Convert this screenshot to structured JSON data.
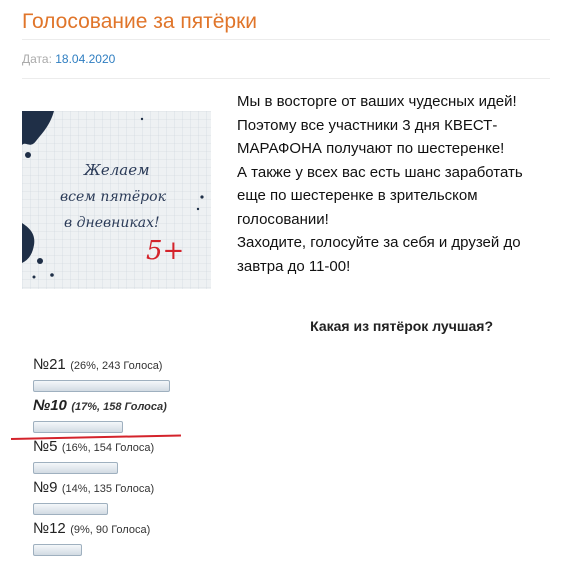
{
  "page": {
    "title": "Голосование за пятёрки",
    "date_label": "Дата:",
    "date_value": "18.04.2020"
  },
  "image": {
    "line1": "Желаем",
    "line2": "всем пятёрок",
    "line3": "в дневниках!",
    "mark": "5+"
  },
  "text": {
    "lines": [
      "Мы в восторге от ваших чудесных идей!",
      "Поэтому все участники 3 дня КВЕСТ-МАРАФОНА получают по шестеренке!",
      "А также у всех вас есть шанс заработать еще по шестеренке в зрительском голосовании!",
      "Заходите, голосуйте за себя и друзей до завтра до 11-00!"
    ]
  },
  "poll": {
    "question": "Какая из пятёрок лучшая?",
    "items": [
      {
        "label": "№21",
        "meta": "(26%, 243 Голоса)",
        "percent": 26
      },
      {
        "label": "№10",
        "meta": "(17%, 158 Голоса)",
        "percent": 17
      },
      {
        "label": "№5",
        "meta": "(16%, 154 Голоса)",
        "percent": 16
      },
      {
        "label": "№9",
        "meta": "(14%, 135 Голоса)",
        "percent": 14
      },
      {
        "label": "№12",
        "meta": "(9%, 90 Голоса)",
        "percent": 9
      }
    ]
  },
  "colors": {
    "title": "#e0752a",
    "link": "#2f7ec1",
    "annotation_line": "#d4232b"
  }
}
